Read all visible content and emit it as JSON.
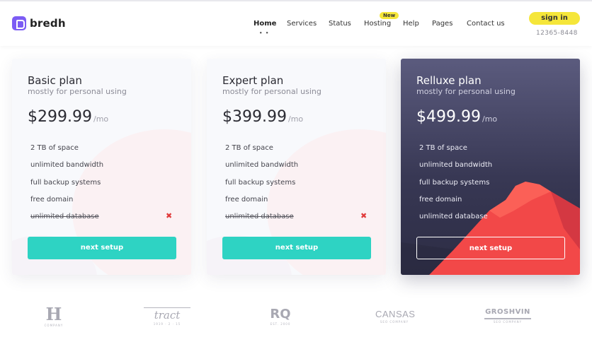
{
  "header": {
    "logo_text": "bredh",
    "nav": [
      {
        "label": "Home",
        "active": true,
        "dots": "• •"
      },
      {
        "label": "Services"
      },
      {
        "label": "Status"
      },
      {
        "label": "Hosting",
        "badge": "New"
      },
      {
        "label": "Help"
      },
      {
        "label": "Pages"
      },
      {
        "label": "Contact us"
      }
    ],
    "signin_label": "sign in",
    "phone": "12365-8448"
  },
  "plans": [
    {
      "title": "Basic plan",
      "subtitle": "mostly for personal using",
      "price": "$299.99",
      "per": "/mo",
      "features": [
        "2 TB of space",
        "unlimited bandwidth",
        "full backup systems",
        "free domain",
        "unlimited database"
      ],
      "unavailable_feature_mark": "✖",
      "cta": "next setup"
    },
    {
      "title": "Expert plan",
      "subtitle": "mostly for personal using",
      "price": "$399.99",
      "per": "/mo",
      "features": [
        "2 TB of space",
        "unlimited bandwidth",
        "full backup systems",
        "free domain",
        "unlimited database"
      ],
      "unavailable_feature_mark": "✖",
      "cta": "next setup"
    },
    {
      "title": "Relluxe plan",
      "subtitle": "mostly for personal using",
      "price": "$499.99",
      "per": "/mo",
      "features": [
        "2 TB of space",
        "unlimited bandwidth",
        "full backup systems",
        "free domain",
        "unlimited database"
      ],
      "cta": "next setup"
    }
  ],
  "brands": [
    {
      "name": "H",
      "sub": "COMPANY"
    },
    {
      "name": "tract",
      "sub": "1919 · 2 · 15"
    },
    {
      "name": "RQ",
      "sub": "EST. 2000"
    },
    {
      "name": "CANSAS",
      "sub": "SEO COMPANY"
    },
    {
      "name": "GROSHVIN",
      "sub": "SEO COMPANY"
    }
  ],
  "colors": {
    "accent_teal": "#2ed3c3",
    "accent_yellow": "#f5e63a",
    "logo_purple": "#7c5cf4",
    "cross_red": "#e03a3a",
    "mountain_red": "#f24848"
  }
}
